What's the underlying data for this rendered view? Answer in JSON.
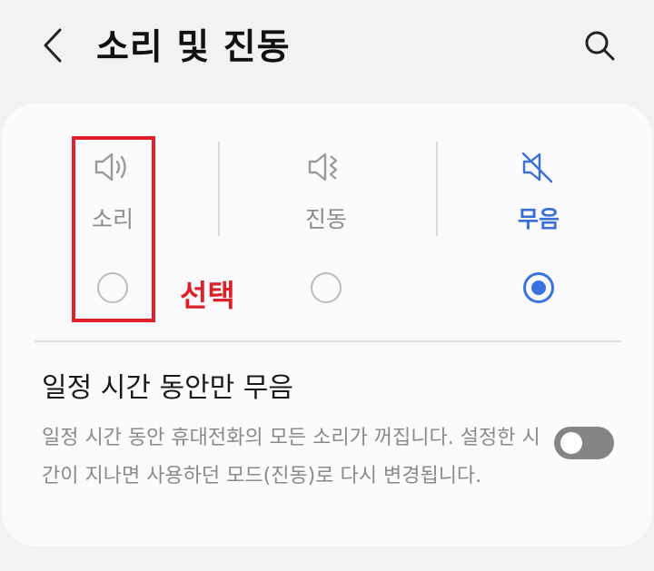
{
  "header": {
    "title": "소리 및 진동",
    "back_icon": "chevron-left-icon",
    "search_icon": "search-icon"
  },
  "modes": [
    {
      "label": "소리",
      "icon": "speaker-sound-icon",
      "selected": false
    },
    {
      "label": "진동",
      "icon": "vibrate-icon",
      "selected": false
    },
    {
      "label": "무음",
      "icon": "mute-icon",
      "selected": true
    }
  ],
  "annotation": {
    "text": "선택",
    "color": "#e0202a"
  },
  "temporary_mute": {
    "title": "일정 시간 동안만 무음",
    "description": "일정 시간 동안 휴대전화의 모든 소리가 꺼집니다. 설정한 시간이 지나면 사용하던 모드(진동)로 다시 변경됩니다.",
    "toggle_on": false
  },
  "colors": {
    "accent": "#3a72e0",
    "background": "#f2f2f4",
    "card": "#fbfbfd"
  }
}
